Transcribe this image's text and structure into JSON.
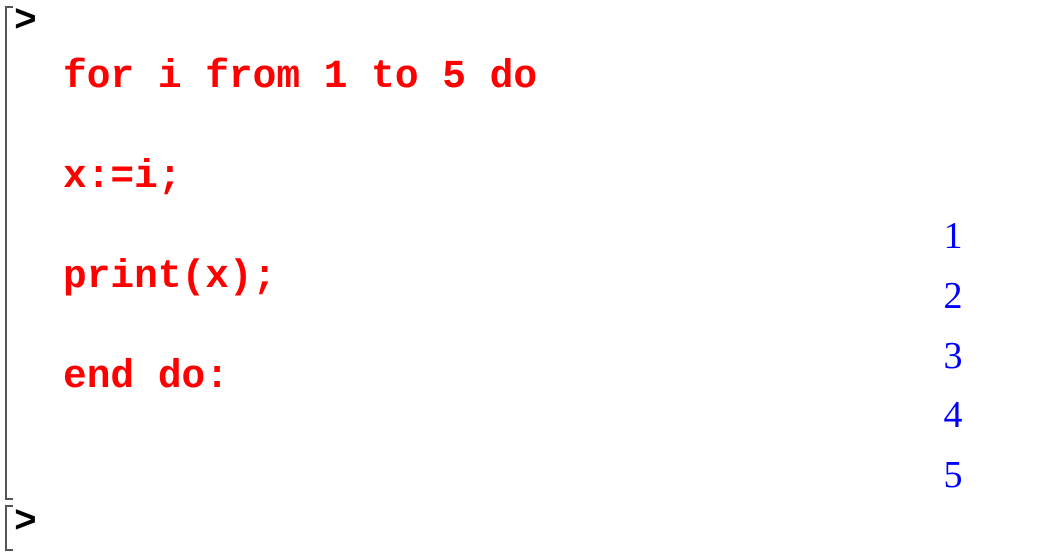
{
  "execution_group": {
    "prompt": ">",
    "code_lines": [
      "for i from 1 to 5 do",
      "x:=i;",
      "print(x);",
      "end do:"
    ],
    "outputs": [
      "1",
      "2",
      "3",
      "4",
      "5"
    ]
  },
  "empty_group": {
    "prompt": ">"
  },
  "colors": {
    "input": "#ff0000",
    "output": "#0000ff"
  }
}
